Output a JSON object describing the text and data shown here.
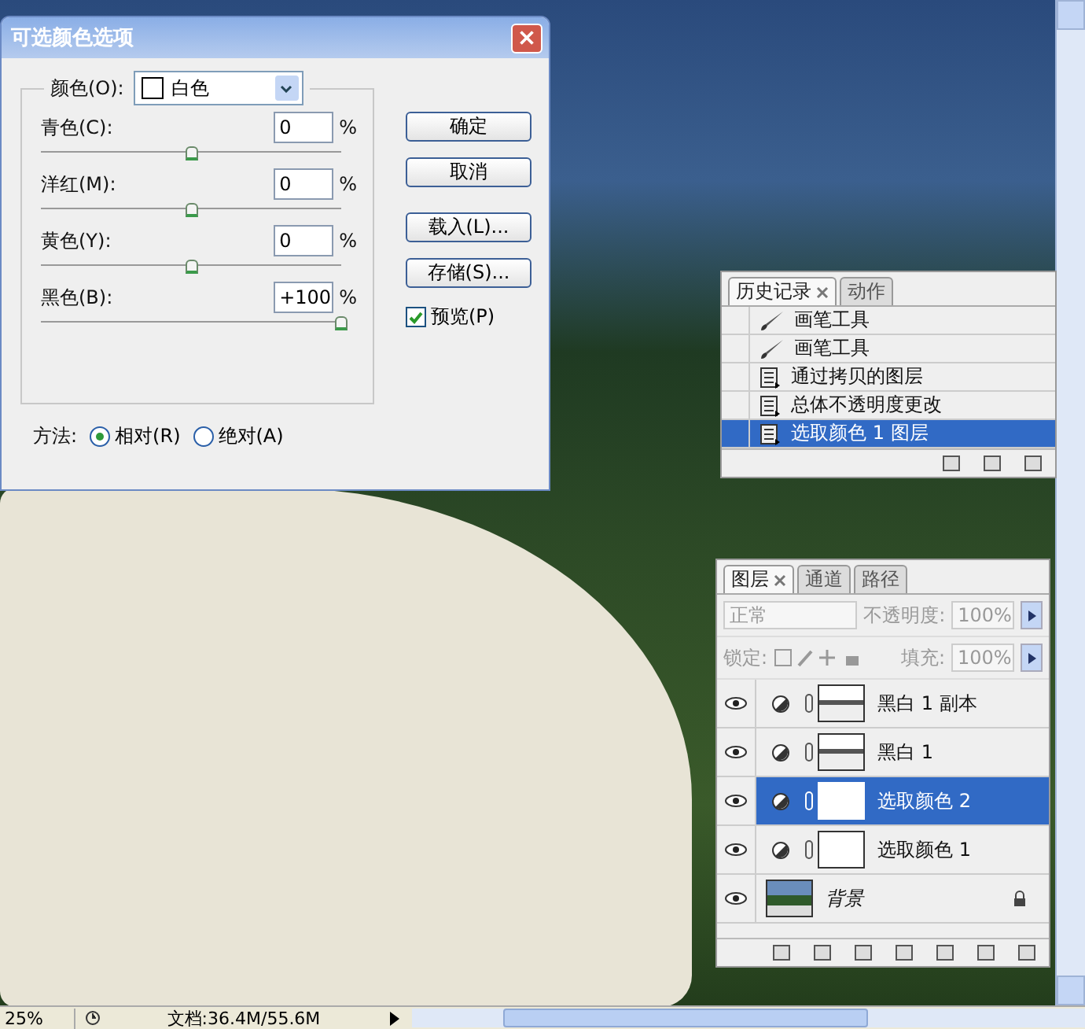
{
  "dialog": {
    "title": "可选颜色选项",
    "color_label": "颜色(O):",
    "color_value": "白色",
    "sliders": [
      {
        "label": "青色(C):",
        "value": "0",
        "unit": "%",
        "level": 0.5
      },
      {
        "label": "洋红(M):",
        "value": "0",
        "unit": "%",
        "level": 0.5
      },
      {
        "label": "黄色(Y):",
        "value": "0",
        "unit": "%",
        "level": 0.5
      },
      {
        "label": "黑色(B):",
        "value": "+100",
        "unit": "%",
        "level": 1
      }
    ],
    "buttons": [
      "确定",
      "取消",
      "载入(L)...",
      "存储(S)..."
    ],
    "preview": {
      "label": "预览(P)",
      "checked": true
    },
    "method": {
      "label": "方法:",
      "options": [
        {
          "label": "相对(R)",
          "selected": true
        },
        {
          "label": "绝对(A)",
          "selected": false
        }
      ]
    }
  },
  "history": {
    "tabs": [
      {
        "label": "历史记录",
        "selected": true
      },
      {
        "label": "动作",
        "selected": false
      }
    ],
    "items": [
      {
        "label": "画笔工具",
        "kind": "brush",
        "selected": false
      },
      {
        "label": "画笔工具",
        "kind": "brush",
        "selected": false
      },
      {
        "label": "通过拷贝的图层",
        "kind": "layer",
        "selected": false
      },
      {
        "label": "总体不透明度更改",
        "kind": "layer",
        "selected": false
      },
      {
        "label": "选取颜色 1 图层",
        "kind": "layer",
        "selected": true
      }
    ]
  },
  "layers": {
    "tabs": [
      {
        "label": "图层",
        "selected": true
      },
      {
        "label": "通道",
        "selected": false
      },
      {
        "label": "路径",
        "selected": false
      }
    ],
    "blend_mode": "正常",
    "opacity_label": "不透明度:",
    "opacity": "100%",
    "lock_label": "锁定:",
    "fill_label": "填充:",
    "fill": "100%",
    "items": [
      {
        "name": "黑白 1 副本",
        "kind": "black_white",
        "selected": false,
        "visible": true
      },
      {
        "name": "黑白 1",
        "kind": "black_white",
        "selected": false,
        "visible": true
      },
      {
        "name": "选取颜色 2",
        "kind": "selective_color",
        "selected": true,
        "visible": true
      },
      {
        "name": "选取颜色 1",
        "kind": "selective_color",
        "selected": false,
        "visible": true
      },
      {
        "name": "背景",
        "kind": "background",
        "selected": false,
        "visible": true
      }
    ]
  },
  "status_bar": {
    "zoom": "25%",
    "document": "文档:36.4M/55.6M"
  }
}
